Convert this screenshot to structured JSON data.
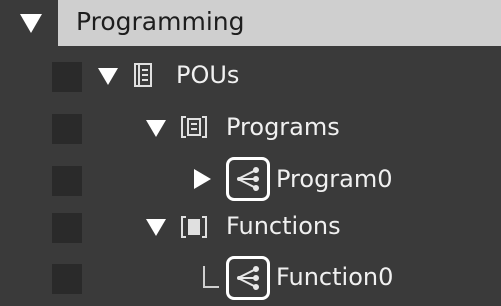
{
  "tree": {
    "header": {
      "title": "Programming",
      "expanded": true
    },
    "items": [
      {
        "label": "POUs",
        "icon": "pou-book-icon",
        "expanded": true,
        "level": 1
      },
      {
        "label": "Programs",
        "icon": "programs-folder-icon",
        "expanded": true,
        "level": 2
      },
      {
        "label": "Program0",
        "icon": "program-network-icon",
        "expanded": false,
        "level": 3
      },
      {
        "label": "Functions",
        "icon": "functions-folder-icon",
        "expanded": true,
        "level": 2
      },
      {
        "label": "Function0",
        "icon": "function-network-icon",
        "level": 3
      }
    ]
  },
  "colors": {
    "panel_bg": "#3a3a3a",
    "header_bg": "#cfcfcf",
    "text": "#f0f0f0",
    "highlight_border": "#ffffff"
  }
}
